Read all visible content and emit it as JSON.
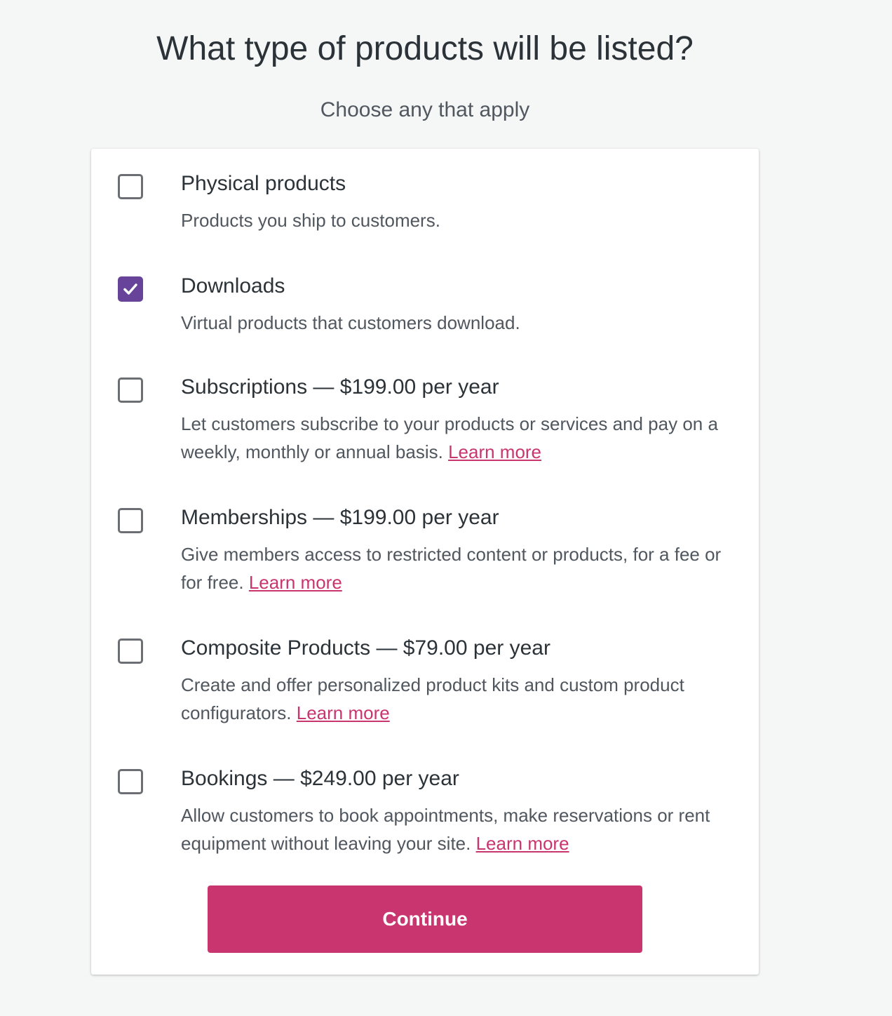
{
  "page": {
    "title": "What type of products will be listed?",
    "subtitle": "Choose any that apply"
  },
  "options": [
    {
      "title": "Physical products",
      "description": "Products you ship to customers.",
      "learn_more": "",
      "checked": false
    },
    {
      "title": "Downloads",
      "description": "Virtual products that customers download.",
      "learn_more": "",
      "checked": true
    },
    {
      "title": "Subscriptions — $199.00 per year",
      "description": "Let customers subscribe to your products or services and pay on a weekly, monthly or annual basis.",
      "learn_more": "Learn more",
      "checked": false
    },
    {
      "title": "Memberships — $199.00 per year",
      "description": "Give members access to restricted content or products, for a fee or for free.",
      "learn_more": "Learn more",
      "checked": false
    },
    {
      "title": "Composite Products — $79.00 per year",
      "description": "Create and offer personalized product kits and custom product configurators.",
      "learn_more": "Learn more",
      "checked": false
    },
    {
      "title": "Bookings — $249.00 per year",
      "description": "Allow customers to book appointments, make reservations or rent equipment without leaving your site.",
      "learn_more": "Learn more",
      "checked": false
    }
  ],
  "continue_label": "Continue",
  "colors": {
    "accent": "#c9356e",
    "checkbox_checked": "#674399"
  },
  "icons": {
    "checkmark": "checkmark-icon"
  }
}
